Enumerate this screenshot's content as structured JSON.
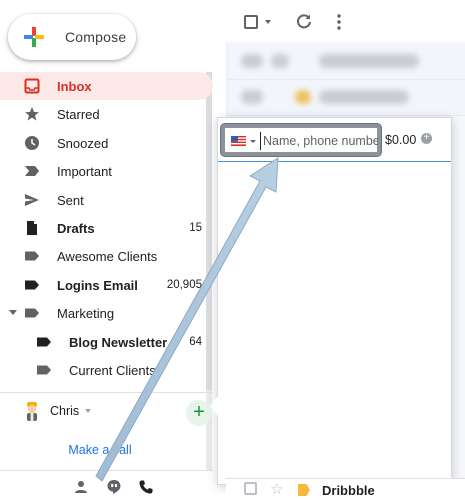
{
  "compose": {
    "label": "Compose"
  },
  "nav": [
    {
      "name": "nav-item-inbox",
      "label": "Inbox",
      "icon": "inbox-icon",
      "active": true,
      "count": ""
    },
    {
      "name": "nav-item-starred",
      "label": "Starred",
      "icon": "star-icon",
      "count": ""
    },
    {
      "name": "nav-item-snoozed",
      "label": "Snoozed",
      "icon": "clock-icon",
      "count": ""
    },
    {
      "name": "nav-item-important",
      "label": "Important",
      "icon": "important-icon",
      "count": ""
    },
    {
      "name": "nav-item-sent",
      "label": "Sent",
      "icon": "send-icon",
      "count": ""
    },
    {
      "name": "nav-item-drafts",
      "label": "Drafts",
      "icon": "draft-icon",
      "bold": true,
      "count": "15"
    },
    {
      "name": "nav-item-awesome-clients",
      "label": "Awesome Clients",
      "icon": "label-icon",
      "count": ""
    },
    {
      "name": "nav-item-logins-email",
      "label": "Logins Email",
      "icon": "label-icon",
      "bold": true,
      "count": "20,905"
    },
    {
      "name": "nav-item-marketing",
      "label": "Marketing",
      "icon": "label-icon",
      "count": ""
    },
    {
      "name": "nav-item-blog-newsletter",
      "label": "Blog Newsletter ..",
      "icon": "label-icon",
      "bold": true,
      "sub": true,
      "count": "64"
    },
    {
      "name": "nav-item-current-clients",
      "label": "Current Clients",
      "icon": "label-icon",
      "sub": true,
      "count": ""
    }
  ],
  "hangouts": {
    "user_name": "Chris",
    "make_call": "Make a call"
  },
  "dialer": {
    "placeholder": "Name, phone number",
    "credit": "$0.00",
    "country": "United States"
  },
  "mail": {
    "last_sender": "Dribbble"
  },
  "colors": {
    "accent_red": "#d93025",
    "link_blue": "#1a73e8",
    "call_green": "#1e8e3e",
    "arrow_blue": "#a9c3da"
  }
}
